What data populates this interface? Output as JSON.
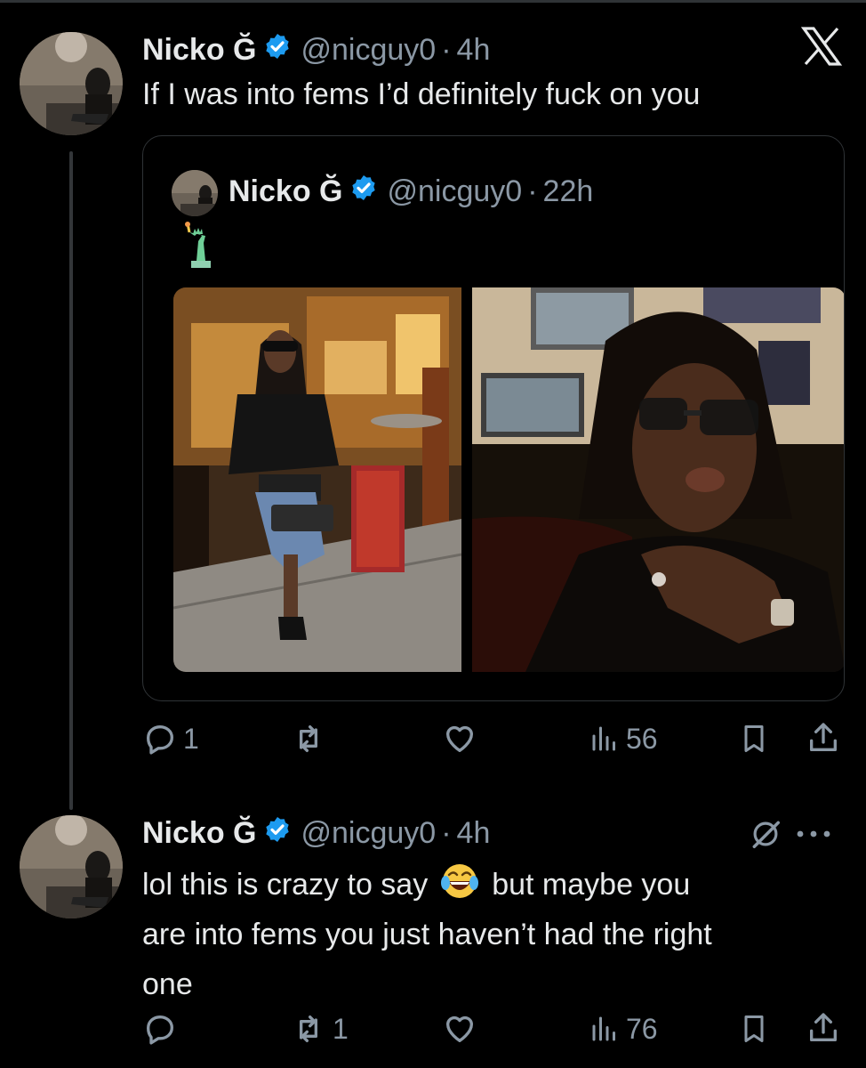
{
  "colors": {
    "background": "#000000",
    "text": "#e7e9ea",
    "secondary": "#8b98a5",
    "verified": "#1d9bf0",
    "border": "#2f3336"
  },
  "tweet1": {
    "name": "Nicko Ğ",
    "handle": "@nicguy0",
    "dot": "·",
    "time": "4h",
    "text": "If I was into fems I’d definitely fuck on you",
    "quote": {
      "name": "Nicko Ğ",
      "handle": "@nicguy0",
      "dot": "·",
      "time": "22h",
      "emoji": "statue-of-liberty"
    },
    "actions": {
      "replies": "1",
      "reposts": "",
      "likes": "",
      "views": "56"
    }
  },
  "tweet2": {
    "name": "Nicko Ğ",
    "handle": "@nicguy0",
    "dot": "·",
    "time": "4h",
    "text_line1_a": "lol this is crazy to say",
    "text_emoji": "😂",
    "text_line1_b": "but maybe you",
    "text_line2": "are into fems you just haven’t had the right",
    "text_line3": "one",
    "actions": {
      "replies": "",
      "reposts": "1",
      "likes": "",
      "views": "76"
    }
  }
}
